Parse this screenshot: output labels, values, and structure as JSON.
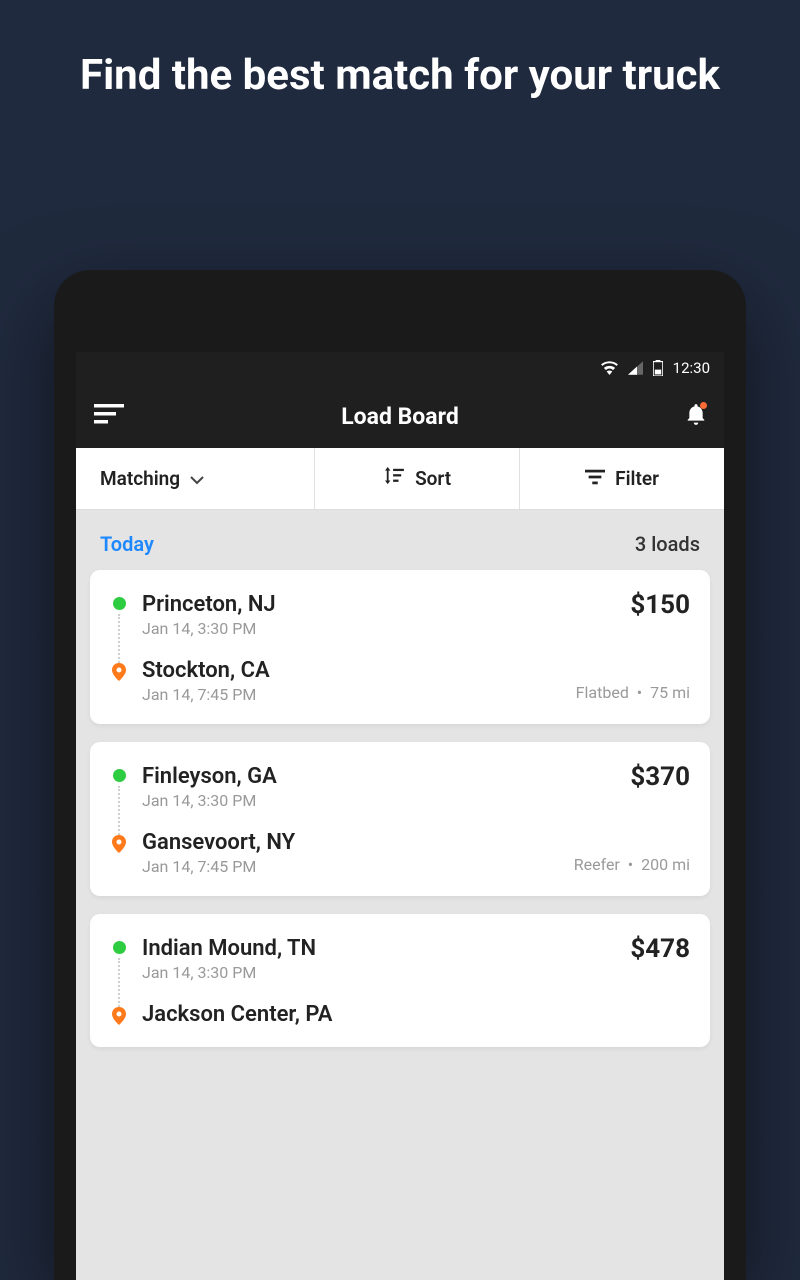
{
  "promo_title": "Find the best match for your truck",
  "status": {
    "time": "12:30"
  },
  "header": {
    "title": "Load Board"
  },
  "controls": {
    "matching_label": "Matching",
    "sort_label": "Sort",
    "filter_label": "Filter"
  },
  "section": {
    "date_label": "Today",
    "count_label": "3 loads"
  },
  "loads": [
    {
      "price": "$150",
      "origin_city": "Princeton, NJ",
      "origin_time": "Jan 14, 3:30 PM",
      "dest_city": "Stockton, CA",
      "dest_time": "Jan 14, 7:45 PM",
      "equipment": "Flatbed",
      "distance": "75 mi"
    },
    {
      "price": "$370",
      "origin_city": "Finleyson, GA",
      "origin_time": "Jan 14, 3:30 PM",
      "dest_city": "Gansevoort, NY",
      "dest_time": "Jan 14, 7:45 PM",
      "equipment": "Reefer",
      "distance": "200 mi"
    },
    {
      "price": "$478",
      "origin_city": "Indian Mound, TN",
      "origin_time": "Jan 14, 3:30 PM",
      "dest_city": "Jackson Center, PA",
      "dest_time": "",
      "equipment": "",
      "distance": ""
    }
  ]
}
